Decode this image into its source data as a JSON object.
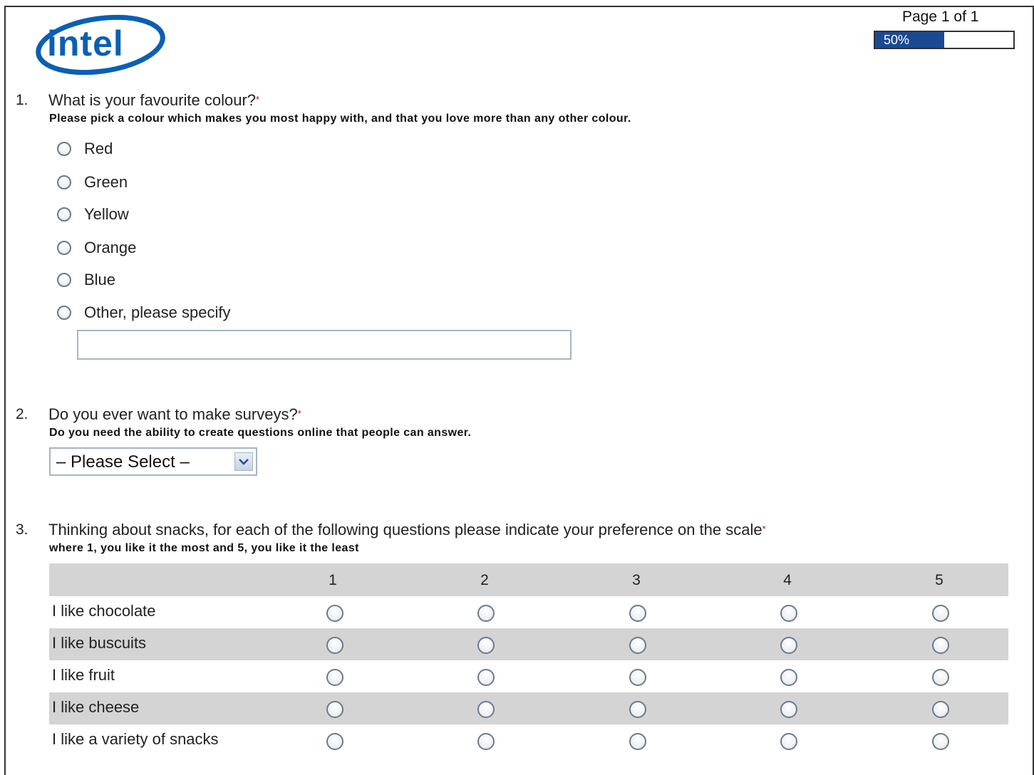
{
  "header": {
    "logo_text": "intel",
    "page_indicator": "Page 1 of 1",
    "progress": {
      "percent": 50,
      "label": "50%"
    },
    "colors": {
      "brand": "#0a5fb4",
      "progress_fill": "#1a4a93",
      "required": "#cc0000"
    }
  },
  "q1": {
    "number": "1.",
    "text": "What is your favourite colour?",
    "required_mark": "*",
    "help": "Please pick a colour which makes you most happy with, and that you love more than any other colour.",
    "options": [
      "Red",
      "Green",
      "Yellow",
      "Orange",
      "Blue",
      "Other, please specify"
    ],
    "other_value": ""
  },
  "q2": {
    "number": "2.",
    "text": "Do you ever want to make surveys?",
    "required_mark": "*",
    "help": "Do you need the ability to create questions online that people can answer.",
    "select_value": "– Please Select –"
  },
  "q3": {
    "number": "3.",
    "text": "Thinking about snacks, for each of the following questions please indicate your preference on the scale",
    "required_mark": "*",
    "help": "where 1, you like it the most and 5, you like it the least",
    "columns": [
      "1",
      "2",
      "3",
      "4",
      "5"
    ],
    "rows": [
      "I like chocolate",
      "I like buscuits",
      "I like fruit",
      "I like cheese",
      "I like a variety of snacks"
    ]
  }
}
